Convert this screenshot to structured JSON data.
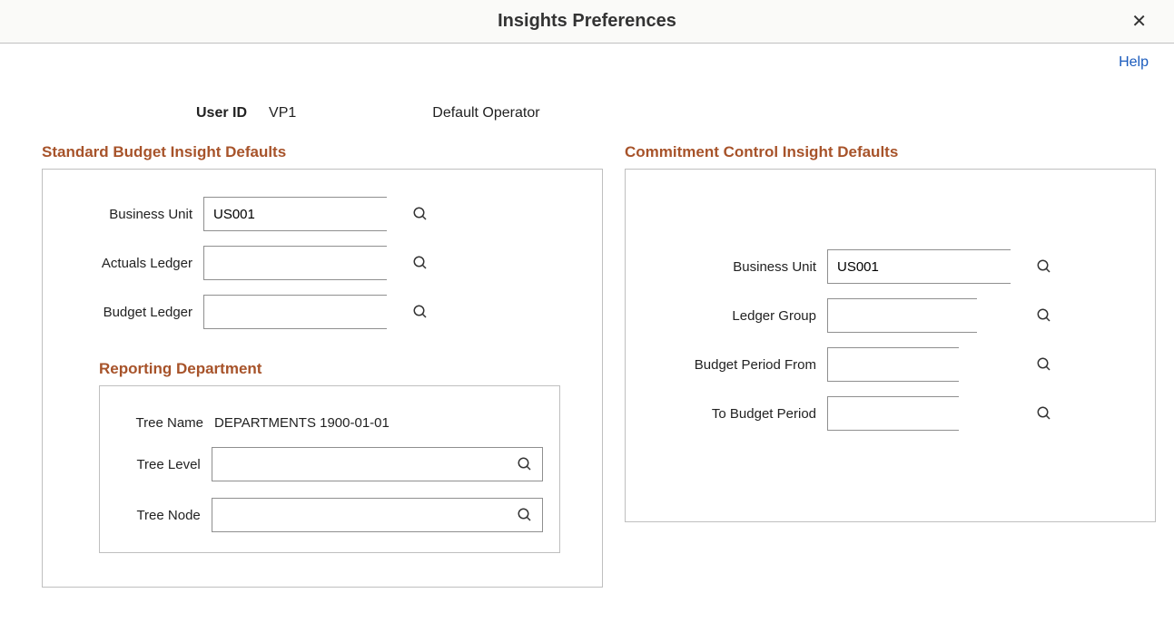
{
  "header": {
    "title": "Insights Preferences",
    "help": "Help"
  },
  "user": {
    "id_label": "User ID",
    "id_value": "VP1",
    "default_operator": "Default Operator"
  },
  "standard": {
    "title": "Standard Budget Insight Defaults",
    "business_unit_label": "Business Unit",
    "business_unit_value": "US001",
    "actuals_ledger_label": "Actuals Ledger",
    "actuals_ledger_value": "",
    "budget_ledger_label": "Budget Ledger",
    "budget_ledger_value": "",
    "reporting": {
      "title": "Reporting Department",
      "tree_name_label": "Tree Name",
      "tree_name_value": "DEPARTMENTS 1900-01-01",
      "tree_level_label": "Tree Level",
      "tree_level_value": "",
      "tree_node_label": "Tree Node",
      "tree_node_value": ""
    }
  },
  "commitment": {
    "title": "Commitment Control Insight Defaults",
    "business_unit_label": "Business Unit",
    "business_unit_value": "US001",
    "ledger_group_label": "Ledger Group",
    "ledger_group_value": "",
    "budget_period_from_label": "Budget Period From",
    "budget_period_from_value": "",
    "to_budget_period_label": "To Budget Period",
    "to_budget_period_value": ""
  }
}
